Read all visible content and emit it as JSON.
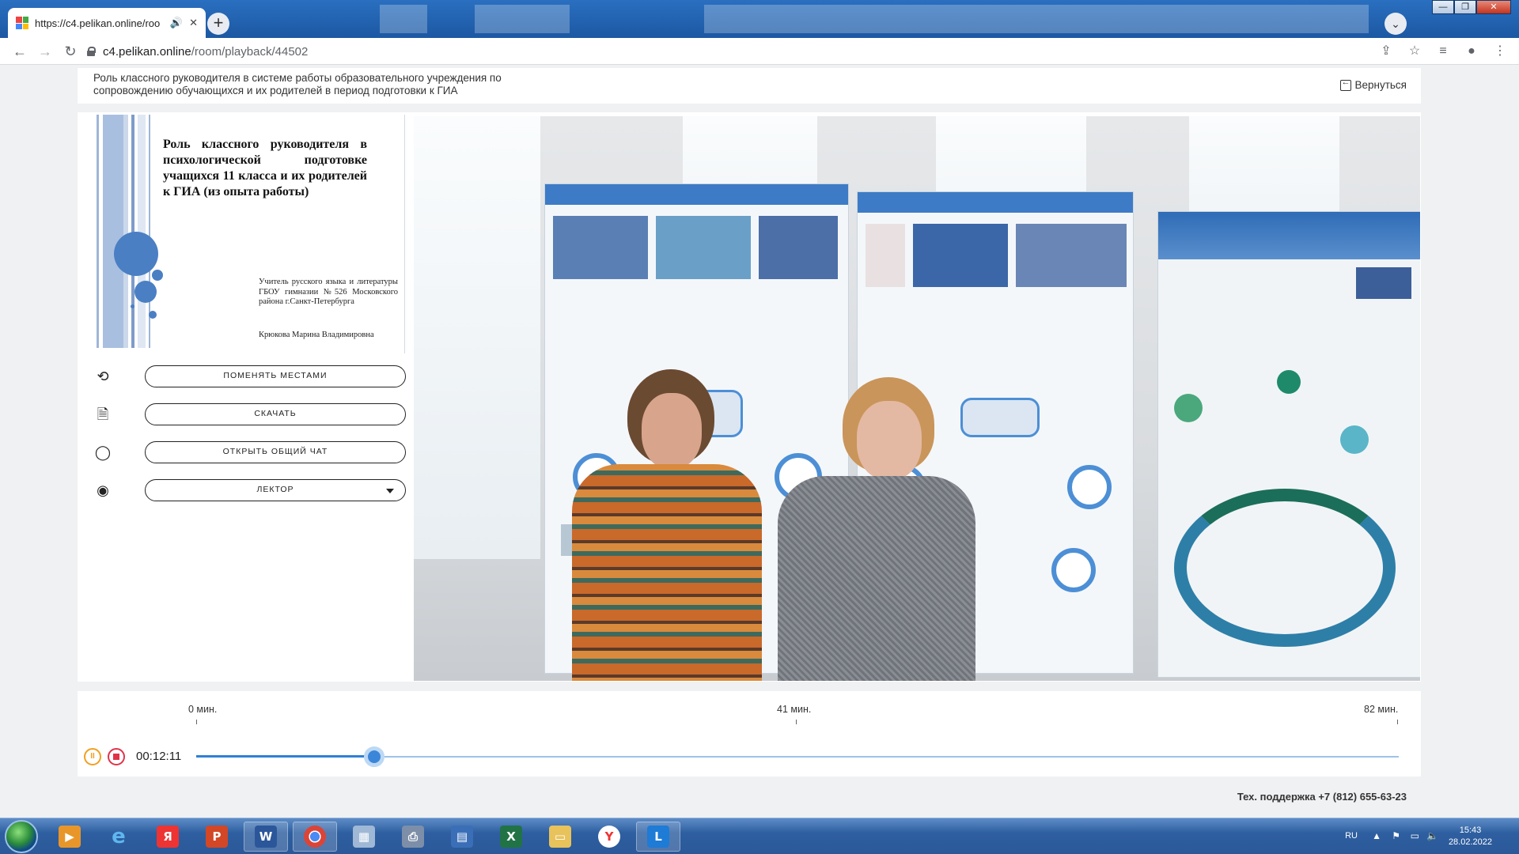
{
  "browser": {
    "tab_title": "https://c4.pelikan.online/roo",
    "url_host": "c4.pelikan.online",
    "url_path": "/room/playback/44502",
    "new_tab": "+",
    "window_controls": [
      "—",
      "❐",
      "✕"
    ]
  },
  "header": {
    "lesson_title": "Роль классного руководителя в системе работы образовательного учреждения по сопровождению обучающихся и их родителей в период подготовки к ГИА",
    "back_label": "Вернуться"
  },
  "slide": {
    "title": "Роль классного руководителя в психологической подготовке учащихся 11 класса и их родителей к ГИА (из опыта работы)",
    "author": "Учитель русского языка и литературы ГБОУ гимназии №526 Московского района г.Санкт-Петербурга",
    "name": "Крюкова Марина Владимировна"
  },
  "controls": [
    {
      "label": "ПОМЕНЯТЬ МЕСТАМИ",
      "icon": "swap-icon"
    },
    {
      "label": "СКАЧАТЬ",
      "icon": "document-icon"
    },
    {
      "label": "ОТКРЫТЬ ОБЩИЙ ЧАТ",
      "icon": "chat-icon"
    },
    {
      "label": "ЛЕКТОР",
      "icon": "webcam-icon"
    }
  ],
  "timeline": {
    "ticks": [
      "0 мин.",
      "41 мин.",
      "82 мин."
    ],
    "current_time": "00:12:11",
    "progress_fraction": 0.148,
    "pause_label": "II"
  },
  "support": "Тех. поддержка +7 (812) 655-63-23",
  "tray": {
    "lang": "RU",
    "time": "15:43",
    "date": "28.02.2022"
  },
  "colors": {
    "accent": "#2f80d6",
    "pause": "#f0a020",
    "stop": "#e0334a"
  }
}
